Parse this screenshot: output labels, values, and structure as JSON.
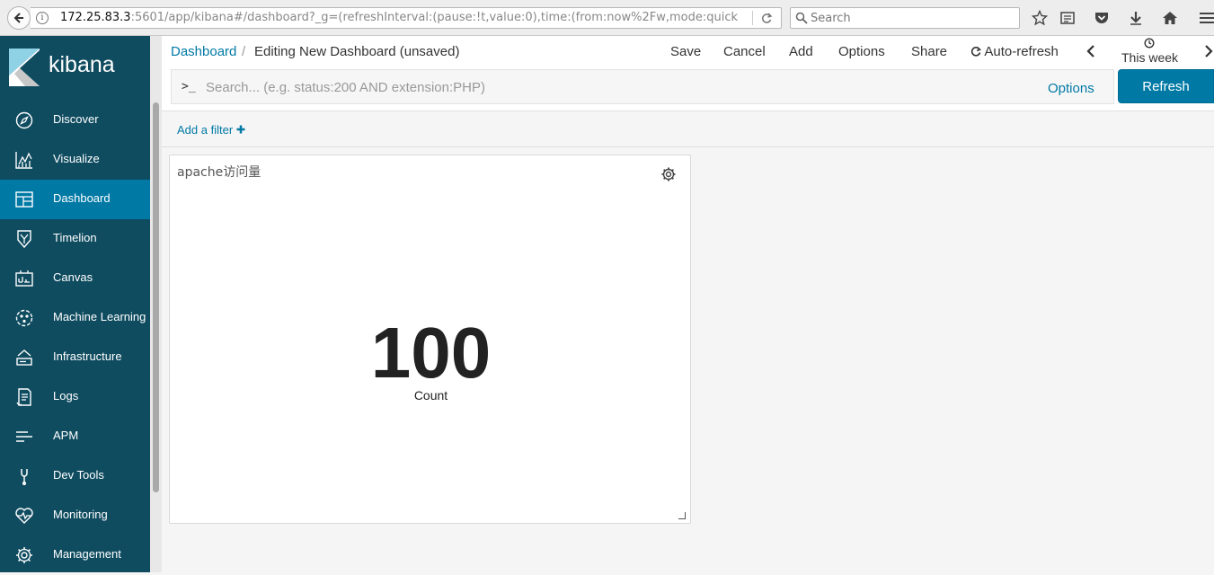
{
  "browser": {
    "url_host": "172.25.83.3",
    "url_path": ":5601/app/kibana#/dashboard?_g=(refreshInterval:(pause:!t,value:0),time:(from:now%2Fw,mode:quick",
    "search_placeholder": "Search"
  },
  "app": {
    "logo_text": "kibana"
  },
  "sidebar": {
    "items": [
      {
        "label": "Discover",
        "icon": "compass-icon"
      },
      {
        "label": "Visualize",
        "icon": "chart-icon"
      },
      {
        "label": "Dashboard",
        "icon": "dashboard-icon",
        "active": true
      },
      {
        "label": "Timelion",
        "icon": "timelion-icon"
      },
      {
        "label": "Canvas",
        "icon": "canvas-icon"
      },
      {
        "label": "Machine Learning",
        "icon": "ml-icon"
      },
      {
        "label": "Infrastructure",
        "icon": "infrastructure-icon"
      },
      {
        "label": "Logs",
        "icon": "logs-icon"
      },
      {
        "label": "APM",
        "icon": "apm-icon"
      },
      {
        "label": "Dev Tools",
        "icon": "wrench-icon"
      },
      {
        "label": "Monitoring",
        "icon": "heartbeat-icon"
      },
      {
        "label": "Management",
        "icon": "gear-icon"
      }
    ]
  },
  "topnav": {
    "breadcrumb_root": "Dashboard",
    "breadcrumb_sep": "/",
    "breadcrumb_current": "Editing New Dashboard (unsaved)",
    "save": "Save",
    "cancel": "Cancel",
    "add": "Add",
    "options": "Options",
    "share": "Share",
    "auto_refresh": "Auto-refresh",
    "time_range": "This week"
  },
  "query": {
    "prompt": ">_",
    "placeholder": "Search... (e.g. status:200 AND extension:PHP)",
    "options": "Options",
    "refresh": "Refresh"
  },
  "filter": {
    "add_filter": "Add a filter"
  },
  "panel": {
    "title": "apache访问量",
    "metric_value": "100",
    "metric_label": "Count"
  },
  "colors": {
    "sidebar_bg": "#0f4c60",
    "active_item": "#0079a5",
    "accent": "#0079a5"
  }
}
